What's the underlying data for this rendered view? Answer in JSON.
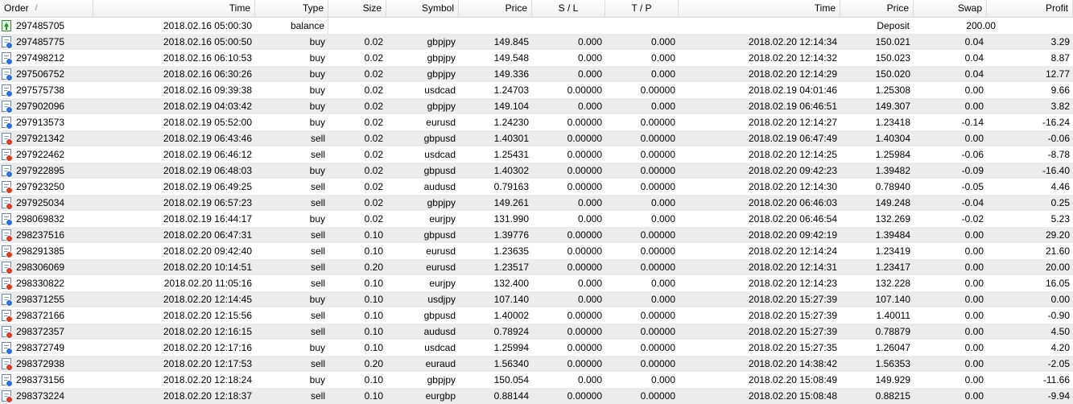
{
  "columns": {
    "order": "Order",
    "sort_mark": "/",
    "time": "Time",
    "type": "Type",
    "size": "Size",
    "symbol": "Symbol",
    "price": "Price",
    "sl": "S / L",
    "tp": "T / P",
    "close_time": "Time",
    "close_price": "Price",
    "swap": "Swap",
    "profit": "Profit"
  },
  "balance_row": {
    "order": "297485705",
    "time": "2018.02.16 05:00:30",
    "type": "balance",
    "comment": "Deposit",
    "profit": "200.00",
    "icon": "balance-icon"
  },
  "trades": [
    {
      "order": "297485775",
      "time": "2018.02.16 05:00:50",
      "type": "buy",
      "size": "0.02",
      "symbol": "gbpjpy",
      "price": "149.845",
      "sl": "0.000",
      "tp": "0.000",
      "close_time": "2018.02.20 12:14:34",
      "close_price": "150.021",
      "swap": "0.04",
      "profit": "3.29"
    },
    {
      "order": "297498212",
      "time": "2018.02.16 06:10:53",
      "type": "buy",
      "size": "0.02",
      "symbol": "gbpjpy",
      "price": "149.548",
      "sl": "0.000",
      "tp": "0.000",
      "close_time": "2018.02.20 12:14:32",
      "close_price": "150.023",
      "swap": "0.04",
      "profit": "8.87"
    },
    {
      "order": "297506752",
      "time": "2018.02.16 06:30:26",
      "type": "buy",
      "size": "0.02",
      "symbol": "gbpjpy",
      "price": "149.336",
      "sl": "0.000",
      "tp": "0.000",
      "close_time": "2018.02.20 12:14:29",
      "close_price": "150.020",
      "swap": "0.04",
      "profit": "12.77"
    },
    {
      "order": "297575738",
      "time": "2018.02.16 09:39:38",
      "type": "buy",
      "size": "0.02",
      "symbol": "usdcad",
      "price": "1.24703",
      "sl": "0.00000",
      "tp": "0.00000",
      "close_time": "2018.02.19 04:01:46",
      "close_price": "1.25308",
      "swap": "0.00",
      "profit": "9.66"
    },
    {
      "order": "297902096",
      "time": "2018.02.19 04:03:42",
      "type": "buy",
      "size": "0.02",
      "symbol": "gbpjpy",
      "price": "149.104",
      "sl": "0.000",
      "tp": "0.000",
      "close_time": "2018.02.19 06:46:51",
      "close_price": "149.307",
      "swap": "0.00",
      "profit": "3.82"
    },
    {
      "order": "297913573",
      "time": "2018.02.19 05:52:00",
      "type": "buy",
      "size": "0.02",
      "symbol": "eurusd",
      "price": "1.24230",
      "sl": "0.00000",
      "tp": "0.00000",
      "close_time": "2018.02.20 12:14:27",
      "close_price": "1.23418",
      "swap": "-0.14",
      "profit": "-16.24"
    },
    {
      "order": "297921342",
      "time": "2018.02.19 06:43:46",
      "type": "sell",
      "size": "0.02",
      "symbol": "gbpusd",
      "price": "1.40301",
      "sl": "0.00000",
      "tp": "0.00000",
      "close_time": "2018.02.19 06:47:49",
      "close_price": "1.40304",
      "swap": "0.00",
      "profit": "-0.06"
    },
    {
      "order": "297922462",
      "time": "2018.02.19 06:46:12",
      "type": "sell",
      "size": "0.02",
      "symbol": "usdcad",
      "price": "1.25431",
      "sl": "0.00000",
      "tp": "0.00000",
      "close_time": "2018.02.20 12:14:25",
      "close_price": "1.25984",
      "swap": "-0.06",
      "profit": "-8.78"
    },
    {
      "order": "297922895",
      "time": "2018.02.19 06:48:03",
      "type": "buy",
      "size": "0.02",
      "symbol": "gbpusd",
      "price": "1.40302",
      "sl": "0.00000",
      "tp": "0.00000",
      "close_time": "2018.02.20 09:42:23",
      "close_price": "1.39482",
      "swap": "-0.09",
      "profit": "-16.40"
    },
    {
      "order": "297923250",
      "time": "2018.02.19 06:49:25",
      "type": "sell",
      "size": "0.02",
      "symbol": "audusd",
      "price": "0.79163",
      "sl": "0.00000",
      "tp": "0.00000",
      "close_time": "2018.02.20 12:14:30",
      "close_price": "0.78940",
      "swap": "-0.05",
      "profit": "4.46"
    },
    {
      "order": "297925034",
      "time": "2018.02.19 06:57:23",
      "type": "sell",
      "size": "0.02",
      "symbol": "gbpjpy",
      "price": "149.261",
      "sl": "0.000",
      "tp": "0.000",
      "close_time": "2018.02.20 06:46:03",
      "close_price": "149.248",
      "swap": "-0.04",
      "profit": "0.25"
    },
    {
      "order": "298069832",
      "time": "2018.02.19 16:44:17",
      "type": "buy",
      "size": "0.02",
      "symbol": "eurjpy",
      "price": "131.990",
      "sl": "0.000",
      "tp": "0.000",
      "close_time": "2018.02.20 06:46:54",
      "close_price": "132.269",
      "swap": "-0.02",
      "profit": "5.23"
    },
    {
      "order": "298237516",
      "time": "2018.02.20 06:47:31",
      "type": "sell",
      "size": "0.10",
      "symbol": "gbpusd",
      "price": "1.39776",
      "sl": "0.00000",
      "tp": "0.00000",
      "close_time": "2018.02.20 09:42:19",
      "close_price": "1.39484",
      "swap": "0.00",
      "profit": "29.20"
    },
    {
      "order": "298291385",
      "time": "2018.02.20 09:42:40",
      "type": "sell",
      "size": "0.10",
      "symbol": "eurusd",
      "price": "1.23635",
      "sl": "0.00000",
      "tp": "0.00000",
      "close_time": "2018.02.20 12:14:24",
      "close_price": "1.23419",
      "swap": "0.00",
      "profit": "21.60"
    },
    {
      "order": "298306069",
      "time": "2018.02.20 10:14:51",
      "type": "sell",
      "size": "0.20",
      "symbol": "eurusd",
      "price": "1.23517",
      "sl": "0.00000",
      "tp": "0.00000",
      "close_time": "2018.02.20 12:14:31",
      "close_price": "1.23417",
      "swap": "0.00",
      "profit": "20.00"
    },
    {
      "order": "298330822",
      "time": "2018.02.20 11:05:16",
      "type": "sell",
      "size": "0.10",
      "symbol": "eurjpy",
      "price": "132.400",
      "sl": "0.000",
      "tp": "0.000",
      "close_time": "2018.02.20 12:14:23",
      "close_price": "132.228",
      "swap": "0.00",
      "profit": "16.05"
    },
    {
      "order": "298371255",
      "time": "2018.02.20 12:14:45",
      "type": "buy",
      "size": "0.10",
      "symbol": "usdjpy",
      "price": "107.140",
      "sl": "0.000",
      "tp": "0.000",
      "close_time": "2018.02.20 15:27:39",
      "close_price": "107.140",
      "swap": "0.00",
      "profit": "0.00"
    },
    {
      "order": "298372166",
      "time": "2018.02.20 12:15:56",
      "type": "sell",
      "size": "0.10",
      "symbol": "gbpusd",
      "price": "1.40002",
      "sl": "0.00000",
      "tp": "0.00000",
      "close_time": "2018.02.20 15:27:39",
      "close_price": "1.40011",
      "swap": "0.00",
      "profit": "-0.90"
    },
    {
      "order": "298372357",
      "time": "2018.02.20 12:16:15",
      "type": "sell",
      "size": "0.10",
      "symbol": "audusd",
      "price": "0.78924",
      "sl": "0.00000",
      "tp": "0.00000",
      "close_time": "2018.02.20 15:27:39",
      "close_price": "0.78879",
      "swap": "0.00",
      "profit": "4.50"
    },
    {
      "order": "298372749",
      "time": "2018.02.20 12:17:16",
      "type": "buy",
      "size": "0.10",
      "symbol": "usdcad",
      "price": "1.25994",
      "sl": "0.00000",
      "tp": "0.00000",
      "close_time": "2018.02.20 15:27:35",
      "close_price": "1.26047",
      "swap": "0.00",
      "profit": "4.20"
    },
    {
      "order": "298372938",
      "time": "2018.02.20 12:17:53",
      "type": "sell",
      "size": "0.20",
      "symbol": "euraud",
      "price": "1.56340",
      "sl": "0.00000",
      "tp": "0.00000",
      "close_time": "2018.02.20 14:38:42",
      "close_price": "1.56353",
      "swap": "0.00",
      "profit": "-2.05"
    },
    {
      "order": "298373156",
      "time": "2018.02.20 12:18:24",
      "type": "buy",
      "size": "0.10",
      "symbol": "gbpjpy",
      "price": "150.054",
      "sl": "0.000",
      "tp": "0.000",
      "close_time": "2018.02.20 15:08:49",
      "close_price": "149.929",
      "swap": "0.00",
      "profit": "-11.66"
    },
    {
      "order": "298373224",
      "time": "2018.02.20 12:18:37",
      "type": "sell",
      "size": "0.10",
      "symbol": "eurgbp",
      "price": "0.88144",
      "sl": "0.00000",
      "tp": "0.00000",
      "close_time": "2018.02.20 15:08:48",
      "close_price": "0.88215",
      "swap": "0.00",
      "profit": "-9.94"
    }
  ]
}
